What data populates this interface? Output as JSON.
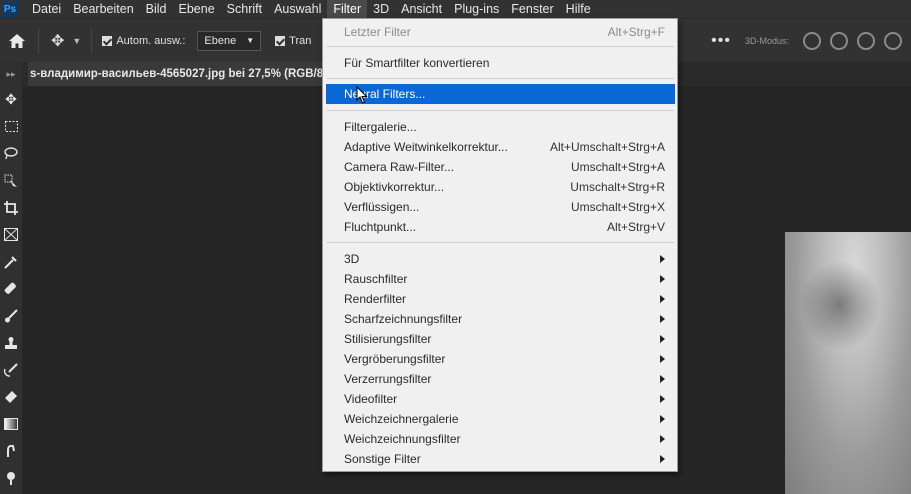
{
  "menubar": {
    "logo": "Ps",
    "items": [
      "Datei",
      "Bearbeiten",
      "Bild",
      "Ebene",
      "Schrift",
      "Auswahl",
      "Filter",
      "3D",
      "Ansicht",
      "Plug-ins",
      "Fenster",
      "Hilfe"
    ],
    "active": "Filter"
  },
  "options": {
    "auto_select_label": "Autom. ausw.:",
    "auto_select_value": "Ebene",
    "transform_label": "Tran",
    "more": "•••",
    "mode_label": "3D-Modus:"
  },
  "document": {
    "tab_title": "s-владимир-васильев-4565027.jpg bei 27,5% (RGB/8"
  },
  "filter_menu": {
    "last_filter": {
      "label": "Letzter Filter",
      "shortcut": "Alt+Strg+F"
    },
    "smart_filter": {
      "label": "Für Smartfilter konvertieren"
    },
    "neural_filters": {
      "label": "Neural Filters..."
    },
    "group1": [
      {
        "label": "Filtergalerie...",
        "shortcut": ""
      },
      {
        "label": "Adaptive Weitwinkelkorrektur...",
        "shortcut": "Alt+Umschalt+Strg+A"
      },
      {
        "label": "Camera Raw-Filter...",
        "shortcut": "Umschalt+Strg+A"
      },
      {
        "label": "Objektivkorrektur...",
        "shortcut": "Umschalt+Strg+R"
      },
      {
        "label": "Verflüssigen...",
        "shortcut": "Umschalt+Strg+X"
      },
      {
        "label": "Fluchtpunkt...",
        "shortcut": "Alt+Strg+V"
      }
    ],
    "submenus": [
      {
        "label": "3D"
      },
      {
        "label": "Rauschfilter"
      },
      {
        "label": "Renderfilter"
      },
      {
        "label": "Scharfzeichnungsfilter"
      },
      {
        "label": "Stilisierungsfilter"
      },
      {
        "label": "Vergröberungsfilter"
      },
      {
        "label": "Verzerrungsfilter"
      },
      {
        "label": "Videofilter"
      },
      {
        "label": "Weichzeichnergalerie"
      },
      {
        "label": "Weichzeichnungsfilter"
      },
      {
        "label": "Sonstige Filter"
      }
    ]
  },
  "colors": {
    "highlight": "#0a68d6",
    "menu_bg": "#f0f0f0",
    "app_bg": "#262626"
  }
}
